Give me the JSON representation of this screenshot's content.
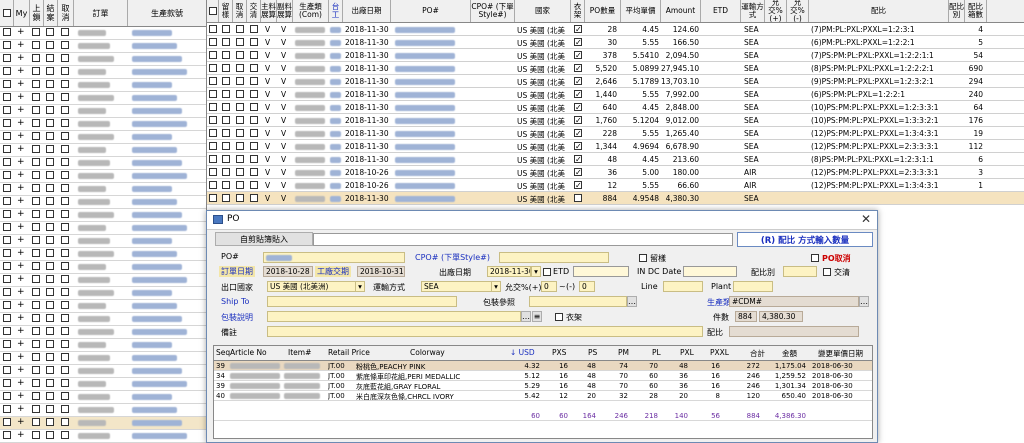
{
  "left_grid": {
    "headers": [
      "My",
      "上鎖",
      "結案",
      "取消",
      "訂單",
      "生產款號"
    ],
    "row_count": 32
  },
  "right_grid": {
    "headers": [
      "留樣",
      "取消",
      "交清",
      "主料展算",
      "副料展算",
      "生產類(Com)",
      "台工",
      "出廠日期",
      "PO#",
      "CPO# (下單Style#)",
      "國家",
      "衣架",
      "PO數量",
      "平均單價",
      "Amount",
      "ETD",
      "運輸方式",
      "允交%(+)",
      "允交%(-)",
      "配比",
      "配比別",
      "配比箱數"
    ],
    "rows": [
      {
        "mark": "V",
        "mark2": "V",
        "date": "2018-11-30",
        "country": "US 美國 (北美",
        "hanger": true,
        "qty": "28",
        "price": "4.45",
        "amount": "124.60",
        "ship": "SEA",
        "ratio": "(7)PM:PL:PXL:PXXL=1:2:3:1",
        "cartons": "4"
      },
      {
        "mark": "V",
        "mark2": "V",
        "date": "2018-11-30",
        "country": "US 美國 (北美",
        "hanger": true,
        "qty": "30",
        "price": "5.55",
        "amount": "166.50",
        "ship": "SEA",
        "ratio": "(6)PM:PL:PXL:PXXL=1:2:2:1",
        "cartons": "5"
      },
      {
        "mark": "V",
        "mark2": "V",
        "date": "2018-11-30",
        "country": "US 美國 (北美",
        "hanger": true,
        "qty": "378",
        "price": "5.5410",
        "amount": "2,094.50",
        "ship": "SEA",
        "ratio": "(7)PS:PM:PL:PXL:PXXL=1:2:2:1:1",
        "cartons": "54"
      },
      {
        "mark": "V",
        "mark2": "V",
        "date": "2018-11-30",
        "country": "US 美國 (北美",
        "hanger": true,
        "qty": "5,520",
        "price": "5.0899",
        "amount": "27,945.10",
        "ship": "SEA",
        "ratio": "(8)PS:PM:PL:PXL:PXXL=1:2:2:2:1",
        "cartons": "690"
      },
      {
        "mark": "V",
        "mark2": "V",
        "date": "2018-11-30",
        "country": "US 美國 (北美",
        "hanger": true,
        "qty": "2,646",
        "price": "5.1789",
        "amount": "13,703.10",
        "ship": "SEA",
        "ratio": "(9)PS:PM:PL:PXL:PXXL=1:2:3:2:1",
        "cartons": "294"
      },
      {
        "mark": "V",
        "mark2": "V",
        "date": "2018-11-30",
        "country": "US 美國 (北美",
        "hanger": true,
        "qty": "1,440",
        "price": "5.55",
        "amount": "7,992.00",
        "ship": "SEA",
        "ratio": "(6)PS:PM:PL:PXL=1:2:2:1",
        "cartons": "240"
      },
      {
        "mark": "V",
        "mark2": "V",
        "date": "2018-11-30",
        "country": "US 美國 (北美",
        "hanger": true,
        "qty": "640",
        "price": "4.45",
        "amount": "2,848.00",
        "ship": "SEA",
        "ratio": "(10)PS:PM:PL:PXL:PXXL=1:2:3:3:1",
        "cartons": "64"
      },
      {
        "mark": "V",
        "mark2": "V",
        "date": "2018-11-30",
        "country": "US 美國 (北美",
        "hanger": true,
        "qty": "1,760",
        "price": "5.1204",
        "amount": "9,012.00",
        "ship": "SEA",
        "ratio": "(10)PS:PM:PL:PXL:PXXL=1:3:3:2:1",
        "cartons": "176"
      },
      {
        "mark": "V",
        "mark2": "V",
        "date": "2018-11-30",
        "country": "US 美國 (北美",
        "hanger": true,
        "qty": "228",
        "price": "5.55",
        "amount": "1,265.40",
        "ship": "SEA",
        "ratio": "(12)PS:PM:PL:PXL:PXXL=1:3:4:3:1",
        "cartons": "19"
      },
      {
        "mark": "V",
        "mark2": "V",
        "date": "2018-11-30",
        "country": "US 美國 (北美",
        "hanger": true,
        "qty": "1,344",
        "price": "4.9694",
        "amount": "6,678.90",
        "ship": "SEA",
        "ratio": "(12)PS:PM:PL:PXL:PXXL=2:3:3:3:1",
        "cartons": "112"
      },
      {
        "mark": "V",
        "mark2": "V",
        "date": "2018-11-30",
        "country": "US 美國 (北美",
        "hanger": true,
        "qty": "48",
        "price": "4.45",
        "amount": "213.60",
        "ship": "SEA",
        "ratio": "(8)PS:PM:PL:PXL:PXXL=1:2:3:1:1",
        "cartons": "6"
      },
      {
        "mark": "V",
        "mark2": "V",
        "date": "2018-10-26",
        "country": "US 美國 (北美",
        "hanger": true,
        "qty": "36",
        "price": "5.00",
        "amount": "180.00",
        "ship": "AIR",
        "ratio": "(12)PS:PM:PL:PXL:PXXL=2:3:3:3:1",
        "cartons": "3"
      },
      {
        "mark": "V",
        "mark2": "V",
        "date": "2018-10-26",
        "country": "US 美國 (北美",
        "hanger": true,
        "qty": "12",
        "price": "5.55",
        "amount": "66.60",
        "ship": "AIR",
        "ratio": "(12)PS:PM:PL:PXL:PXXL=1:3:4:3:1",
        "cartons": "1"
      },
      {
        "mark": "V",
        "mark2": "V",
        "date": "2018-11-30",
        "country": "US 美國 (北美",
        "hanger": false,
        "qty": "884",
        "price": "4.9548",
        "amount": "4,380.30",
        "ship": "SEA",
        "ratio": "",
        "cartons": ""
      }
    ]
  },
  "dialog": {
    "title": "PO",
    "paste_button": "自剪貼簿貼入",
    "ratio_button": "(R) 配比 方式輸入數量",
    "labels": {
      "po": "PO#",
      "cpo": "CPO# (下單Style#)",
      "keep_sample": "留樣",
      "po_cancel": "PO取消",
      "order_date_label": "訂單日期",
      "factory_label": "工廠交期",
      "ship_date": "出廠日期",
      "etd": "ETD",
      "in_dc_date": "IN DC Date",
      "ratio_type": "配比別",
      "closed": "交清",
      "export_country": "出口國家",
      "transport": "運輸方式",
      "tolerance": "允交%(+)",
      "line": "Line",
      "plant": "Plant",
      "ship_to": "Ship To",
      "pack_ref": "包裝參照",
      "prod_type": "生產類",
      "pack_desc": "包裝說明",
      "hanger": "衣架",
      "pieces": "件數",
      "remarks": "備註",
      "ratio": "配比"
    },
    "values": {
      "order_date": "2018-10-28",
      "factory_date": "2018-10-31",
      "ship_date": "2018-11-30",
      "country": "US 美國 (北美洲)",
      "transport": "SEA",
      "tolerance_plus": "0",
      "tolerance_minus": "0",
      "prod_type": "#CDM#",
      "pieces": "884",
      "amount": "4,380.30"
    },
    "table": {
      "headers": [
        "Seq",
        "Article No",
        "Item#",
        "Retail Price",
        "Colorway",
        "↓ USD",
        "PXS",
        "PS",
        "PM",
        "PL",
        "PXL",
        "PXXL",
        "合計",
        "金額",
        "變更單價日期"
      ],
      "rows": [
        {
          "seq": "39",
          "retail": "JT.00",
          "colorway": "粉桃色,PEACHY PINK",
          "usd": "4.32",
          "pxs": "16",
          "ps": "48",
          "pm": "74",
          "pl": "70",
          "pxl": "48",
          "pxxl": "16",
          "total": "272",
          "amount": "1,175.04",
          "date": "2018-06-30"
        },
        {
          "seq": "34",
          "retail": "JT.00",
          "colorway": "紫底條車印花組,PERI MEDALLIC",
          "usd": "5.12",
          "pxs": "16",
          "ps": "48",
          "pm": "70",
          "pl": "60",
          "pxl": "36",
          "pxxl": "16",
          "total": "246",
          "amount": "1,259.52",
          "date": "2018-06-30"
        },
        {
          "seq": "39",
          "retail": "JT.00",
          "colorway": "灰底藍花組,GRAY FLORAL",
          "usd": "5.29",
          "pxs": "16",
          "ps": "48",
          "pm": "70",
          "pl": "60",
          "pxl": "36",
          "pxxl": "16",
          "total": "246",
          "amount": "1,301.34",
          "date": "2018-06-30"
        },
        {
          "seq": "40",
          "retail": "JT.00",
          "colorway": "米白底深灰色條,CHRCL IVORY",
          "usd": "5.42",
          "pxs": "12",
          "ps": "20",
          "pm": "32",
          "pl": "28",
          "pxl": "20",
          "pxxl": "8",
          "total": "120",
          "amount": "650.40",
          "date": "2018-06-30"
        }
      ],
      "totals": {
        "usd": "60",
        "pxs": "60",
        "ps": "164",
        "pm": "246",
        "pl": "218",
        "pxl": "140",
        "pxxl": "56",
        "total": "884",
        "amount": "4,386.30"
      }
    }
  }
}
